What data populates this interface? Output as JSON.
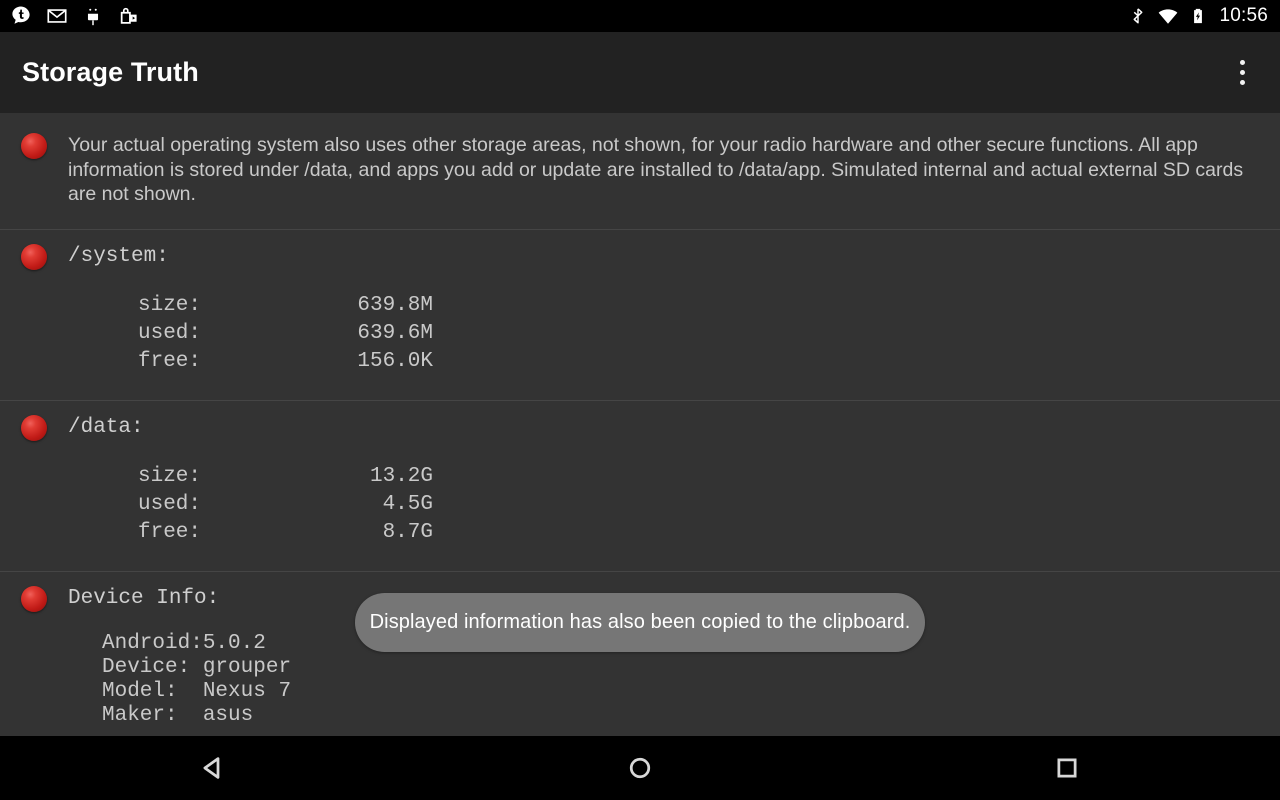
{
  "status_bar": {
    "icons_left": [
      "tumblr-icon",
      "gmail-icon",
      "android-head-icon",
      "play-store-icon"
    ],
    "icons_right": [
      "bluetooth-icon",
      "wifi-icon",
      "battery-charging-icon"
    ],
    "clock": "10:56"
  },
  "action_bar": {
    "title": "Storage Truth",
    "overflow_label": "More options"
  },
  "list": {
    "note": {
      "text": "Your actual operating system also uses other storage areas, not shown, for your radio hardware and other secure functions. All app information is stored under /data, and apps you add or update are installed to /data/app. Simulated internal and actual external SD cards are not shown."
    },
    "system": {
      "heading": "/system:",
      "rows": [
        {
          "label": "size:",
          "value": "639.8M"
        },
        {
          "label": "used:",
          "value": "639.6M"
        },
        {
          "label": "free:",
          "value": "156.0K"
        }
      ]
    },
    "data": {
      "heading": "/data:",
      "rows": [
        {
          "label": "size:",
          "value": "13.2G"
        },
        {
          "label": "used:",
          "value": "4.5G"
        },
        {
          "label": "free:",
          "value": "8.7G"
        }
      ]
    },
    "device": {
      "heading": "Device Info:",
      "rows": [
        {
          "label": "Android:",
          "value": "5.0.2"
        },
        {
          "label": "Device:",
          "value": "grouper"
        },
        {
          "label": "Model:",
          "value": "Nexus 7"
        },
        {
          "label": "Maker:",
          "value": "asus"
        }
      ]
    }
  },
  "toast": {
    "message": "Displayed information has also been copied to the clipboard."
  },
  "nav_bar": {
    "back_label": "Back",
    "home_label": "Home",
    "recents_label": "Recents"
  },
  "colors": {
    "status_bar_bg": "#000000",
    "action_bar_bg": "#222222",
    "content_bg": "#333333",
    "divider": "#454545",
    "text_primary": "#c9c9c9",
    "title_text": "#ffffff",
    "bullet_red": "#c01a16",
    "toast_bg": "#7c7c7c"
  }
}
